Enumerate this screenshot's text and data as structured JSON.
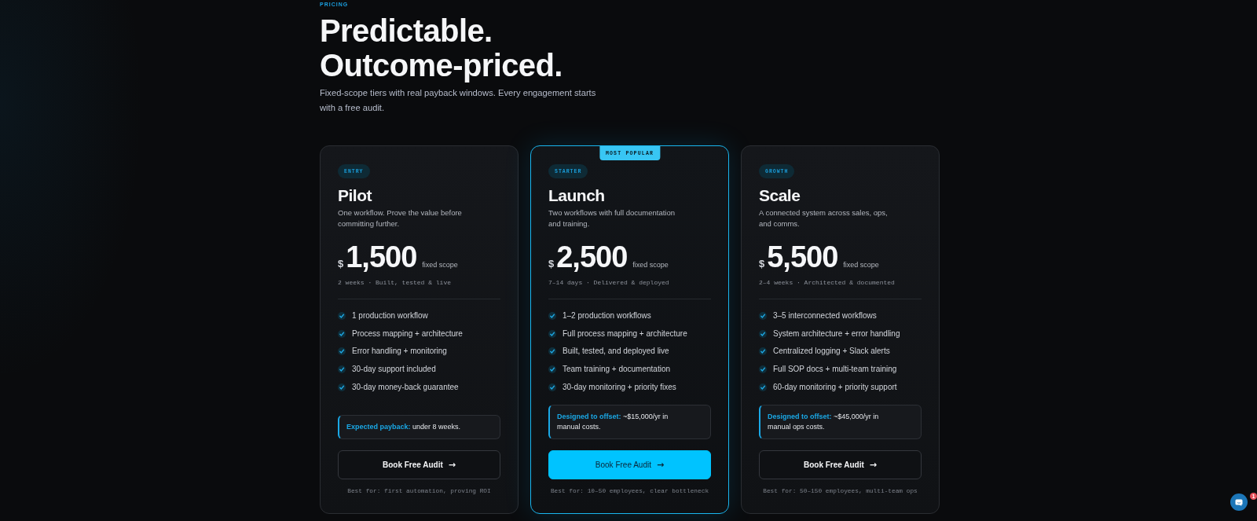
{
  "section": {
    "eyebrow": "PRICING",
    "title_lines": [
      "Predictable.",
      "Outcome-priced."
    ],
    "subtitle": "Fixed-scope tiers with real payback windows. Every engagement starts with a free audit."
  },
  "plans": [
    {
      "featured": false,
      "tier": "ENTRY",
      "name": "Pilot",
      "description": "One workflow. Prove the value before committing further.",
      "currency": "$",
      "price": "1,500",
      "price_note": "fixed scope",
      "timeline": "2 weeks · Built, tested & live",
      "features": [
        "1 production workflow",
        "Process mapping + architecture",
        "Error handling + monitoring",
        "30-day support included",
        "30-day money-back guarantee"
      ],
      "callout": "**Expected payback:** under 8 weeks.",
      "button": {
        "label": "Book Free Audit",
        "arrow": "→"
      },
      "best_for": "Best for: first automation, proving ROI"
    },
    {
      "featured": true,
      "ribbon": "MOST POPULAR",
      "tier": "STARTER",
      "name": "Launch",
      "description": "Two workflows with full documentation and training.",
      "currency": "$",
      "price": "2,500",
      "price_note": "fixed scope",
      "timeline": "7–14 days · Delivered & deployed",
      "features": [
        "1–2 production workflows",
        "Full process mapping + architecture",
        "Built, tested, and deployed live",
        "Team training + documentation",
        "30-day monitoring + priority fixes"
      ],
      "callout": "**Designed to offset:** ~$15,000/yr in manual costs.",
      "button": {
        "label": "Book Free Audit",
        "arrow": "→"
      },
      "best_for": "Best for: 10–50 employees, clear bottleneck"
    },
    {
      "featured": false,
      "tier": "GROWTH",
      "name": "Scale",
      "description": "A connected system across sales, ops, and comms.",
      "currency": "$",
      "price": "5,500",
      "price_note": "fixed scope",
      "timeline": "2–4 weeks · Architected & documented",
      "features": [
        "3–5 interconnected workflows",
        "System architecture + error handling",
        "Centralized logging + Slack alerts",
        "Full SOP docs + multi-team training",
        "60-day monitoring + priority support"
      ],
      "callout": "**Designed to offset:** ~$45,000/yr in manual ops costs.",
      "button": {
        "label": "Book Free Audit",
        "arrow": "→"
      },
      "best_for": "Best for: 50–150 employees, multi-team ops"
    }
  ],
  "chat_launcher": {
    "unread": "1"
  }
}
